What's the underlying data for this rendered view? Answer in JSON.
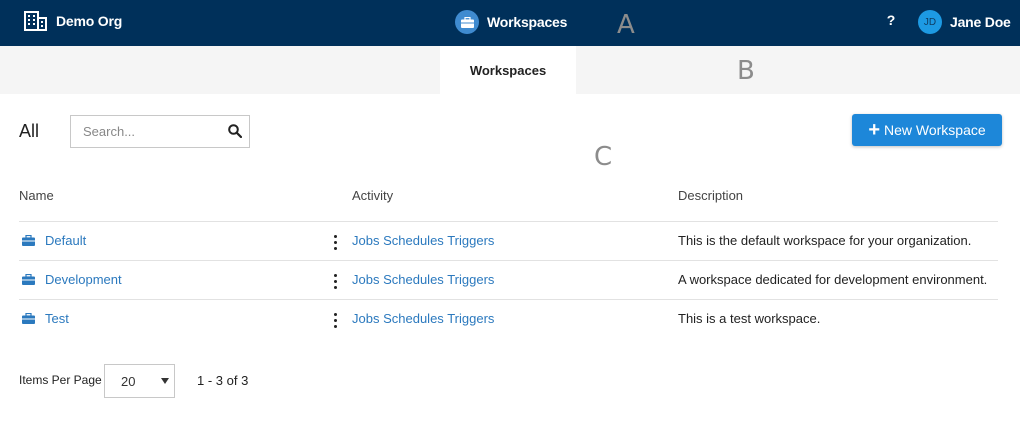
{
  "header": {
    "org_name": "Demo Org",
    "org_icon": "building-icon",
    "app_title": "Workspaces",
    "app_icon": "briefcase-icon",
    "help_label": "?",
    "user_initials": "JD",
    "user_name": "Jane Doe"
  },
  "tabs": [
    {
      "label": "Workspaces",
      "active": true
    }
  ],
  "markers": {
    "a": "A",
    "b": "B",
    "c": "C"
  },
  "toolbar": {
    "filter_label": "All",
    "search_placeholder": "Search...",
    "search_value": "",
    "new_button_label": "New Workspace"
  },
  "table": {
    "columns": [
      "Name",
      "Activity",
      "Description"
    ],
    "rows": [
      {
        "name": "Default",
        "activity": [
          "Jobs",
          "Schedules",
          "Triggers"
        ],
        "description": "This is the default workspace for your organization."
      },
      {
        "name": "Development",
        "activity": [
          "Jobs",
          "Schedules",
          "Triggers"
        ],
        "description": "A workspace dedicated for development environment."
      },
      {
        "name": "Test",
        "activity": [
          "Jobs",
          "Schedules",
          "Triggers"
        ],
        "description": "This is a test workspace."
      }
    ]
  },
  "pagination": {
    "items_per_page_label": "Items Per Page",
    "items_per_page_value": "20",
    "range_text": "1 - 3 of 3"
  },
  "colors": {
    "topbar": "#00305a",
    "accent": "#1d87d9",
    "link": "#2b79be",
    "tabbar": "#f5f5f5"
  }
}
